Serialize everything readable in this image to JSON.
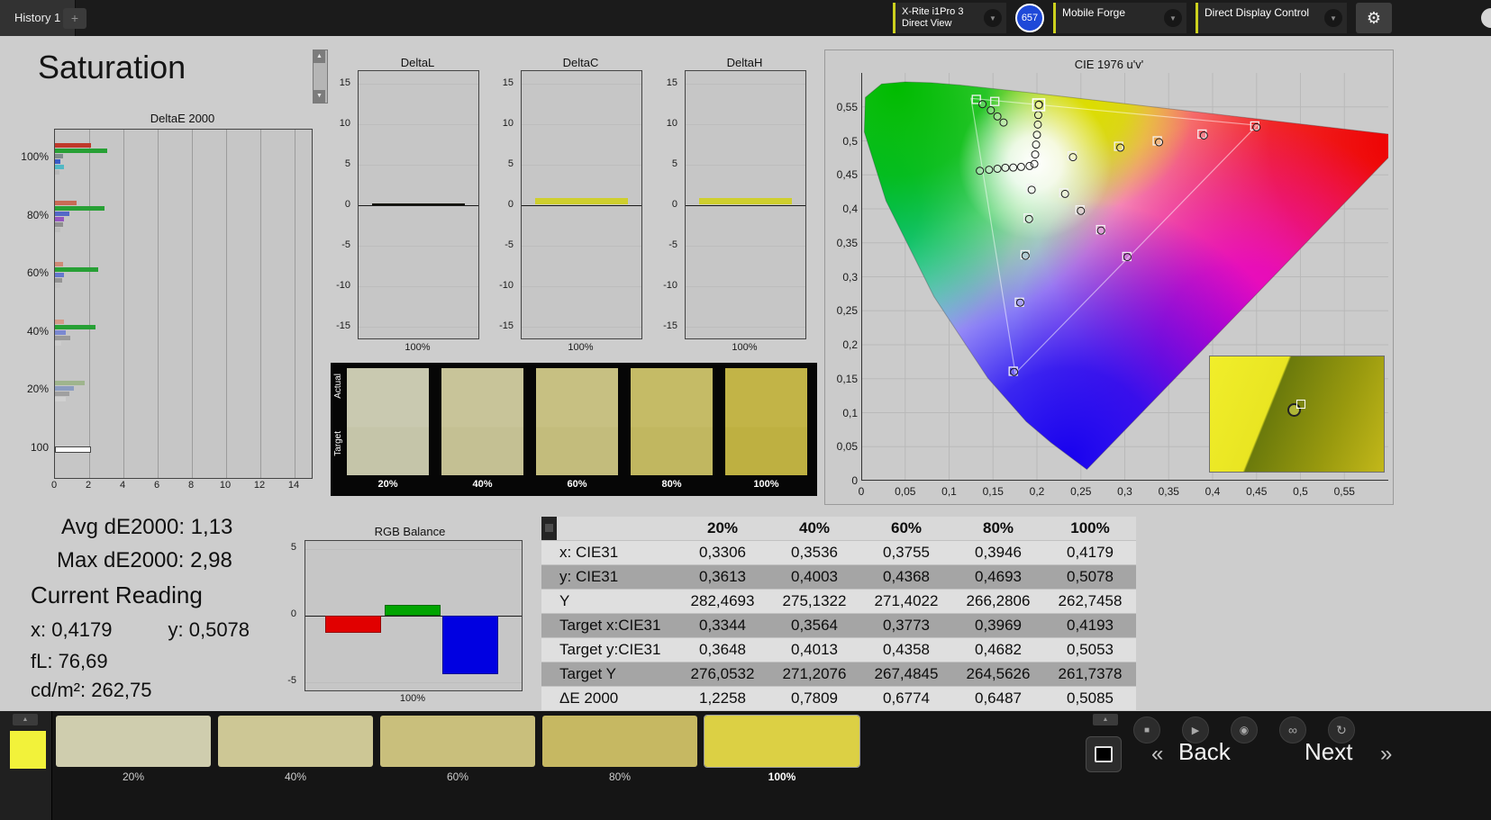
{
  "topbar": {
    "history_tab": "History 1",
    "add_tab": "+",
    "meter_line1": "X-Rite i1Pro 3",
    "meter_line2": "Direct View",
    "badge": "657",
    "source": "Mobile Forge",
    "display_control": "Direct Display Control",
    "chevron": "▼",
    "gear": "⚙",
    "accent_color": "#ccd11e",
    "badge_color": "#1e49d8"
  },
  "page_title": "Saturation",
  "scrollbar": {
    "up": "▲",
    "down": "▼"
  },
  "chart_data": {
    "delta_e": {
      "type": "bar",
      "title": "DeltaE 2000",
      "xmax": 15,
      "xticks": [
        0,
        2,
        4,
        6,
        8,
        10,
        12,
        14
      ],
      "groups": [
        {
          "label": "100%",
          "bars": [
            {
              "c": "#c0392b",
              "v": 2.1
            },
            {
              "c": "#27a035",
              "v": 3.05
            },
            {
              "c": "#7f8c8d",
              "v": 0.45
            },
            {
              "c": "#3a5bc7",
              "v": 0.3
            },
            {
              "c": "#52b8c4",
              "v": 0.5
            },
            {
              "c": "#b9b9b9",
              "v": 0.25
            }
          ]
        },
        {
          "label": "80%",
          "bars": [
            {
              "c": "#c96a55",
              "v": 1.25
            },
            {
              "c": "#27a035",
              "v": 2.9
            },
            {
              "c": "#5468c8",
              "v": 0.85
            },
            {
              "c": "#9456c0",
              "v": 0.5
            },
            {
              "c": "#8f8f8f",
              "v": 0.45
            },
            {
              "c": "#bdbdbd",
              "v": 0.3
            }
          ]
        },
        {
          "label": "60%",
          "bars": [
            {
              "c": "#cf8a76",
              "v": 0.45
            },
            {
              "c": "#27a035",
              "v": 2.5
            },
            {
              "c": "#6577cd",
              "v": 0.5
            },
            {
              "c": "#949494",
              "v": 0.4
            },
            {
              "c": "#c2c2c2",
              "v": 0.3
            }
          ]
        },
        {
          "label": "40%",
          "bars": [
            {
              "c": "#d49a87",
              "v": 0.55
            },
            {
              "c": "#27a035",
              "v": 2.35
            },
            {
              "c": "#7a89d1",
              "v": 0.65
            },
            {
              "c": "#9a9a9a",
              "v": 0.9
            },
            {
              "c": "#cccccc",
              "v": 0.35
            }
          ]
        },
        {
          "label": "20%",
          "bars": [
            {
              "c": "#9fb58d",
              "v": 1.75
            },
            {
              "c": "#8b9cc0",
              "v": 1.1
            },
            {
              "c": "#a0a0a0",
              "v": 0.85
            },
            {
              "c": "#d0d0d0",
              "v": 0.65
            }
          ]
        },
        {
          "label": "100",
          "bars": [
            {
              "c": "#ffffff",
              "v": 2.0
            }
          ]
        }
      ]
    },
    "mini_charts": [
      {
        "title": "DeltaL",
        "value": 0.12,
        "color": "#14140a",
        "xlabel": "100%"
      },
      {
        "title": "DeltaC",
        "value": 0.85,
        "color": "#cfcf2e",
        "xlabel": "100%"
      },
      {
        "title": "DeltaH",
        "value": 0.8,
        "color": "#cfcf2e",
        "xlabel": "100%"
      }
    ],
    "mini_yticks": [
      15,
      10,
      5,
      0,
      -5,
      -10,
      -15
    ],
    "rgb_balance": {
      "type": "bar",
      "title": "RGB Balance",
      "yticks": [
        5,
        0,
        -5
      ],
      "xlabel": "100%",
      "bars": [
        {
          "name": "red",
          "v": -1.3,
          "c": "#e10000"
        },
        {
          "name": "green",
          "v": 0.8,
          "c": "#00a400"
        },
        {
          "name": "blue",
          "v": -4.4,
          "c": "#0000e1"
        }
      ]
    },
    "cie": {
      "type": "scatter",
      "title": "CIE 1976 u'v'",
      "yticks": [
        "0,55",
        "0,5",
        "0,45",
        "0,4",
        "0,35",
        "0,3",
        "0,25",
        "0,2",
        "0,15",
        "0,1",
        "0,05",
        "0"
      ],
      "xticks": [
        "0",
        "0,05",
        "0,1",
        "0,15",
        "0,2",
        "0,25",
        "0,3",
        "0,35",
        "0,4",
        "0,45",
        "0,5",
        "0,55"
      ],
      "circles": [
        [
          0.138,
          0.554
        ],
        [
          0.1475,
          0.545
        ],
        [
          0.155,
          0.536
        ],
        [
          0.162,
          0.527
        ],
        [
          0.198,
          0.48
        ],
        [
          0.199,
          0.4945
        ],
        [
          0.2,
          0.509
        ],
        [
          0.201,
          0.524
        ],
        [
          0.2015,
          0.538
        ],
        [
          0.2024,
          0.5534
        ],
        [
          0.135,
          0.456
        ],
        [
          0.1455,
          0.4575
        ],
        [
          0.155,
          0.459
        ],
        [
          0.164,
          0.4605
        ],
        [
          0.173,
          0.4607
        ],
        [
          0.182,
          0.4617
        ],
        [
          0.1916,
          0.463
        ],
        [
          0.197,
          0.466
        ],
        [
          0.241,
          0.476
        ],
        [
          0.295,
          0.49
        ],
        [
          0.339,
          0.498
        ],
        [
          0.39,
          0.508
        ],
        [
          0.45,
          0.52
        ],
        [
          0.232,
          0.422
        ],
        [
          0.25,
          0.397
        ],
        [
          0.273,
          0.368
        ],
        [
          0.303,
          0.329
        ],
        [
          0.194,
          0.428
        ],
        [
          0.191,
          0.385
        ],
        [
          0.187,
          0.331
        ],
        [
          0.181,
          0.262
        ],
        [
          0.174,
          0.16
        ]
      ],
      "squares": [
        [
          0.131,
          0.561
        ],
        [
          0.152,
          0.558
        ],
        [
          0.24,
          0.478
        ],
        [
          0.293,
          0.492
        ],
        [
          0.337,
          0.5
        ],
        [
          0.388,
          0.51
        ],
        [
          0.448,
          0.522
        ],
        [
          0.2305,
          0.4235
        ],
        [
          0.249,
          0.3985
        ],
        [
          0.2725,
          0.3694
        ],
        [
          0.3023,
          0.3298
        ],
        [
          0.193,
          0.43
        ],
        [
          0.19,
          0.3865
        ],
        [
          0.1865,
          0.3325
        ],
        [
          0.18,
          0.2625
        ],
        [
          0.173,
          0.161
        ]
      ],
      "current": [
        0.202,
        0.553
      ]
    }
  },
  "strip": {
    "row_labels": [
      "Actual",
      "Target"
    ],
    "items": [
      {
        "label": "20%",
        "actual": "#c9c9b0",
        "target": "#c5c5a9"
      },
      {
        "label": "40%",
        "actual": "#c8c499",
        "target": "#c4c093"
      },
      {
        "label": "60%",
        "actual": "#c7c082",
        "target": "#c3bc7c"
      },
      {
        "label": "80%",
        "actual": "#c5bb66",
        "target": "#c1b760"
      },
      {
        "label": "100%",
        "actual": "#c2b447",
        "target": "#beb041"
      }
    ]
  },
  "stats": {
    "avg": "Avg dE2000: 1,13",
    "max": "Max dE2000: 2,98",
    "current_heading": "Current Reading",
    "x": "x: 0,4179",
    "y": "y: 0,5078",
    "fl": "fL: 76,69",
    "cdm2": "cd/m²: 262,75"
  },
  "table": {
    "header": [
      "20%",
      "40%",
      "60%",
      "80%",
      "100%"
    ],
    "rows": [
      {
        "label": "x: CIE31",
        "values": [
          "0,3306",
          "0,3536",
          "0,3755",
          "0,3946",
          "0,4179"
        ]
      },
      {
        "label": "y: CIE31",
        "values": [
          "0,3613",
          "0,4003",
          "0,4368",
          "0,4693",
          "0,5078"
        ]
      },
      {
        "label": "Y",
        "values": [
          "282,4693",
          "275,1322",
          "271,4022",
          "266,2806",
          "262,7458"
        ]
      },
      {
        "label": "Target x:CIE31",
        "values": [
          "0,3344",
          "0,3564",
          "0,3773",
          "0,3969",
          "0,4193"
        ]
      },
      {
        "label": "Target y:CIE31",
        "values": [
          "0,3648",
          "0,4013",
          "0,4358",
          "0,4682",
          "0,5053"
        ]
      },
      {
        "label": "Target Y",
        "values": [
          "276,0532",
          "271,2076",
          "267,4845",
          "264,5626",
          "261,7378"
        ]
      },
      {
        "label": "ΔE 2000",
        "values": [
          "1,2258",
          "0,7809",
          "0,6774",
          "0,6487",
          "0,5085"
        ]
      }
    ]
  },
  "bottombar": {
    "current_color": "#f2f23a",
    "patches": [
      {
        "label": "20%",
        "color": "#cfcdae",
        "selected": false
      },
      {
        "label": "40%",
        "color": "#cdc795",
        "selected": false
      },
      {
        "label": "60%",
        "color": "#c9bf7c",
        "selected": false
      },
      {
        "label": "80%",
        "color": "#c6b862",
        "selected": false
      },
      {
        "label": "100%",
        "color": "#dcd044",
        "selected": true
      }
    ],
    "transport": [
      {
        "name": "stop",
        "glyph": "■"
      },
      {
        "name": "play",
        "glyph": "▶"
      },
      {
        "name": "record",
        "glyph": "◉"
      },
      {
        "name": "loop",
        "glyph": "∞"
      },
      {
        "name": "refresh",
        "glyph": "↻"
      }
    ],
    "up_arrow": "▲",
    "back": "Back",
    "next": "Next",
    "back_chevron": "«",
    "next_chevron": "»"
  }
}
